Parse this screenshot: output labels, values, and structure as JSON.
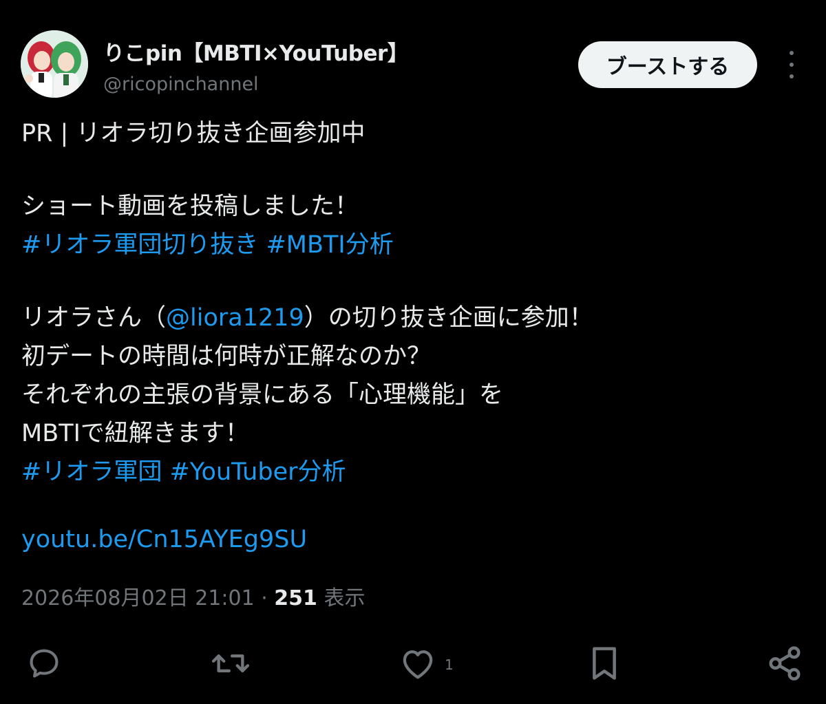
{
  "author": {
    "display_name": "りこpin【MBTI×YouTuber】",
    "handle": "@ricopinchannel"
  },
  "boost_label": "ブーストする",
  "tweet": {
    "line1": "PR | リオラ切り抜き企画参加中",
    "line2": "ショート動画を投稿しました！",
    "hashtag1": "#リオラ軍団切り抜き",
    "hashtag2": "#MBTI分析",
    "line4_pre": "リオラさん（",
    "mention": "@liora1219",
    "line4_post": "）の切り抜き企画に参加！",
    "line5": "初デートの時間は何時が正解なのか？",
    "line6": "それぞれの主張の背景にある「心理機能」を",
    "line7": "MBTIで紐解きます！",
    "hashtag3": "#リオラ軍団",
    "hashtag4": "#YouTuber分析",
    "link": "youtu.be/Cn15AYEg9SU"
  },
  "meta": {
    "timestamp": "2026年08月02日 21:01",
    "separator": " · ",
    "views_count": "251",
    "views_label": " 表示"
  },
  "actions": {
    "like_count": "1"
  },
  "icons": [
    "reply-icon",
    "repost-icon",
    "like-icon",
    "bookmark-icon",
    "share-icon",
    "more-icon"
  ],
  "colors": {
    "background": "#000000",
    "text": "#e7e9ea",
    "secondary": "#71767b",
    "link": "#1d9bf0",
    "button_bg": "#eff3f4"
  }
}
